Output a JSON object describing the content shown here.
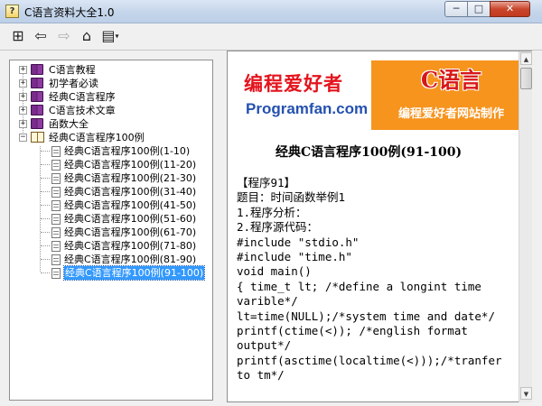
{
  "window": {
    "title": "C语言资料大全1.0",
    "min_glyph": "─",
    "max_glyph": "□",
    "close_glyph": "✕"
  },
  "toolbar": {
    "hide_icon": "⊞",
    "back_icon": "⇦",
    "forward_icon": "⇨",
    "home_icon": "⌂",
    "options_icon": "▤",
    "options_caret": "▾"
  },
  "tree": {
    "expand_glyph": "+",
    "collapse_glyph": "−",
    "items": [
      {
        "label": "C语言教程"
      },
      {
        "label": "初学者必读"
      },
      {
        "label": "经典C语言程序"
      },
      {
        "label": "C语言技术文章"
      },
      {
        "label": "函数大全"
      },
      {
        "label": "经典C语言程序100例"
      }
    ],
    "children": [
      {
        "label": "经典C语言程序100例(1-10)"
      },
      {
        "label": "经典C语言程序100例(11-20)"
      },
      {
        "label": "经典C语言程序100例(21-30)"
      },
      {
        "label": "经典C语言程序100例(31-40)"
      },
      {
        "label": "经典C语言程序100例(41-50)"
      },
      {
        "label": "经典C语言程序100例(51-60)"
      },
      {
        "label": "经典C语言程序100例(61-70)"
      },
      {
        "label": "经典C语言程序100例(71-80)"
      },
      {
        "label": "经典C语言程序100例(81-90)"
      },
      {
        "label": "经典C语言程序100例(91-100)"
      }
    ]
  },
  "content": {
    "banner": {
      "brand_cn": "编程爱好者",
      "brand_en": "Programfan.com",
      "logo_text": "C语言",
      "tagline": "编程爱好者网站制作"
    },
    "heading": "经典C语言程序100例(91-100)",
    "lines": [
      "【程序91】",
      "题目：时间函数举例1",
      "1.程序分析：",
      "2.程序源代码：",
      "#include \"stdio.h\"",
      "#include \"time.h\"",
      "void main()",
      "{ time_t lt; /*define a longint time",
      "varible*/",
      "lt=time(NULL);/*system time and date*/",
      "printf(ctime(<)); /*english format",
      "output*/",
      "printf(asctime(localtime(<)));/*tranfer",
      "to tm*/"
    ]
  },
  "scrollbar": {
    "up_glyph": "▲",
    "down_glyph": "▼"
  },
  "colors": {
    "brand_red": "#e4131d",
    "brand_blue": "#2451b0",
    "banner_orange": "#f6941e",
    "selection": "#3399ff"
  }
}
